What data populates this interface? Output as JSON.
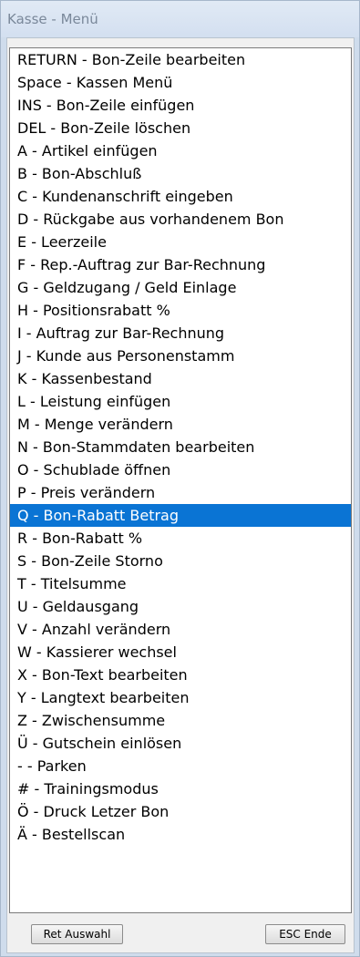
{
  "window": {
    "title": "Kasse - Menü"
  },
  "menu": {
    "selected_index": 20,
    "items": [
      "RETURN - Bon-Zeile bearbeiten",
      "Space - Kassen Menü",
      "INS - Bon-Zeile einfügen",
      "DEL - Bon-Zeile löschen",
      "A - Artikel einfügen",
      "B - Bon-Abschluß",
      "C - Kundenanschrift eingeben",
      "D - Rückgabe aus vorhandenem Bon",
      "E - Leerzeile",
      "F - Rep.-Auftrag zur Bar-Rechnung",
      "G - Geldzugang / Geld Einlage",
      "H - Positionsrabatt %",
      "I - Auftrag zur Bar-Rechnung",
      "J - Kunde aus Personenstamm",
      "K - Kassenbestand",
      "L - Leistung einfügen",
      "M - Menge verändern",
      "N - Bon-Stammdaten bearbeiten",
      "O - Schublade öffnen",
      "P - Preis verändern",
      "Q - Bon-Rabatt Betrag",
      "R - Bon-Rabatt %",
      "S - Bon-Zeile Storno",
      "T - Titelsumme",
      "U - Geldausgang",
      "V - Anzahl verändern",
      "W - Kassierer wechsel",
      "X - Bon-Text bearbeiten",
      "Y - Langtext bearbeiten",
      "Z - Zwischensumme",
      "Ü - Gutschein einlösen",
      "- - Parken",
      "# - Trainingsmodus",
      "Ö - Druck Letzer Bon",
      "Ä - Bestellscan"
    ]
  },
  "buttons": {
    "ret_label": "Ret Auswahl",
    "esc_label": "ESC Ende"
  },
  "colors": {
    "selection": "#0a74d4",
    "titlebar": "#d9e4f2",
    "dialog_bg": "#f0f0f0"
  }
}
